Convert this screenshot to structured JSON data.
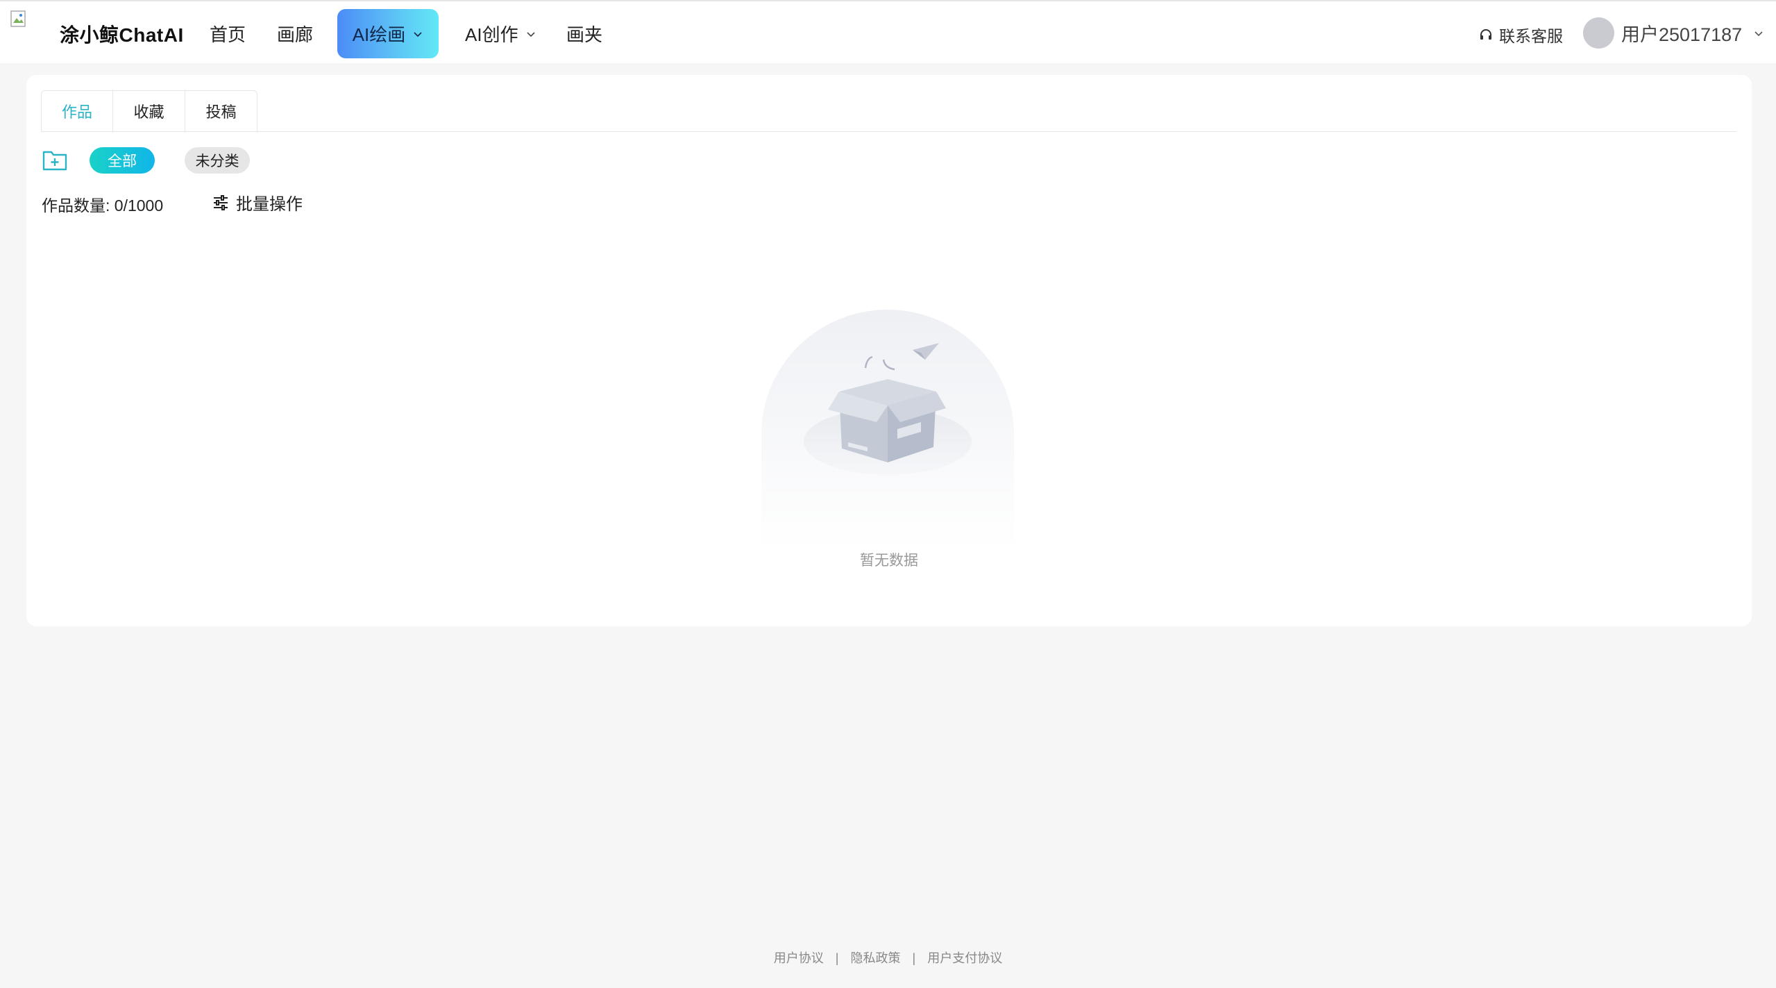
{
  "header": {
    "brand": "涂小鲸ChatAI",
    "nav": {
      "home": "首页",
      "gallery": "画廊",
      "ai_draw": "AI绘画",
      "ai_create": "AI创作",
      "folder": "画夹"
    },
    "support": "联系客服",
    "username": "用户25017187"
  },
  "tabs": [
    "作品",
    "收藏",
    "投稿"
  ],
  "filters": {
    "all": "全部",
    "uncategorized": "未分类"
  },
  "work_count": "作品数量: 0/1000",
  "batch_label": "批量操作",
  "empty_text": "暂无数据",
  "footer": {
    "user_agreement": "用户协议",
    "privacy": "隐私政策",
    "payment": "用户支付协议",
    "separator": "|"
  },
  "colors": {
    "active_tab": "#2bb3c6",
    "accent_gradient_start": "#19d2c8",
    "accent_gradient_end": "#12b5e8"
  }
}
